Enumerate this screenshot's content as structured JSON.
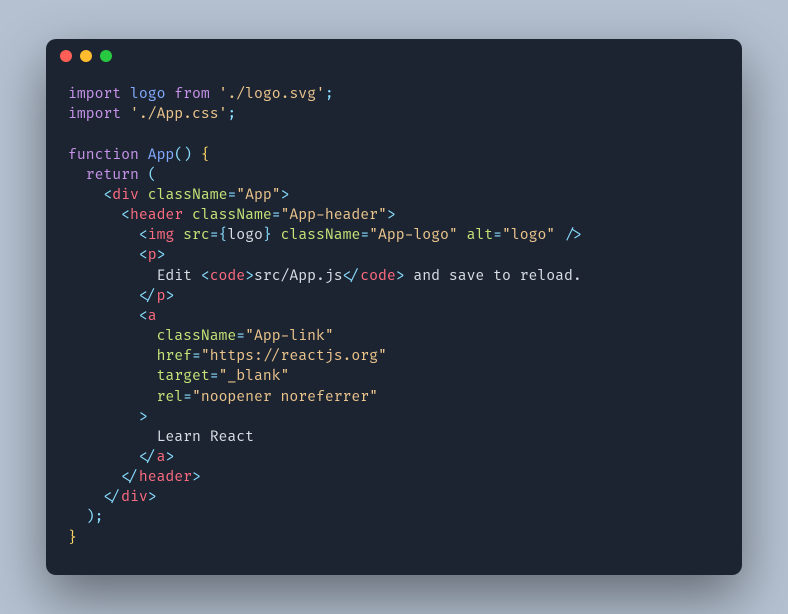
{
  "window": {
    "traffic_lights": [
      "close",
      "minimize",
      "zoom"
    ]
  },
  "code": {
    "language": "javascript-jsx",
    "filename_hint": "App.js",
    "tokens": [
      {
        "t": "kw",
        "v": "import"
      },
      {
        "t": "sp",
        "v": " "
      },
      {
        "t": "def",
        "v": "logo"
      },
      {
        "t": "sp",
        "v": " "
      },
      {
        "t": "from",
        "v": "from"
      },
      {
        "t": "sp",
        "v": " "
      },
      {
        "t": "str",
        "v": "'./logo.svg'"
      },
      {
        "t": "punc",
        "v": ";"
      },
      {
        "t": "nl"
      },
      {
        "t": "kw",
        "v": "import"
      },
      {
        "t": "sp",
        "v": " "
      },
      {
        "t": "str",
        "v": "'./App.css'"
      },
      {
        "t": "punc",
        "v": ";"
      },
      {
        "t": "nl"
      },
      {
        "t": "nl"
      },
      {
        "t": "kw",
        "v": "function"
      },
      {
        "t": "sp",
        "v": " "
      },
      {
        "t": "def",
        "v": "App"
      },
      {
        "t": "punc",
        "v": "()"
      },
      {
        "t": "sp",
        "v": " "
      },
      {
        "t": "brace",
        "v": "{"
      },
      {
        "t": "nl"
      },
      {
        "t": "sp",
        "v": "  "
      },
      {
        "t": "kw",
        "v": "return"
      },
      {
        "t": "sp",
        "v": " "
      },
      {
        "t": "punc",
        "v": "("
      },
      {
        "t": "nl"
      },
      {
        "t": "sp",
        "v": "    "
      },
      {
        "t": "punc",
        "v": "<"
      },
      {
        "t": "tag",
        "v": "div"
      },
      {
        "t": "sp",
        "v": " "
      },
      {
        "t": "attr",
        "v": "className"
      },
      {
        "t": "punc",
        "v": "="
      },
      {
        "t": "str",
        "v": "\"App\""
      },
      {
        "t": "punc",
        "v": ">"
      },
      {
        "t": "nl"
      },
      {
        "t": "sp",
        "v": "      "
      },
      {
        "t": "punc",
        "v": "<"
      },
      {
        "t": "tag",
        "v": "header"
      },
      {
        "t": "sp",
        "v": " "
      },
      {
        "t": "attr",
        "v": "className"
      },
      {
        "t": "punc",
        "v": "="
      },
      {
        "t": "str",
        "v": "\"App-header\""
      },
      {
        "t": "punc",
        "v": ">"
      },
      {
        "t": "nl"
      },
      {
        "t": "sp",
        "v": "        "
      },
      {
        "t": "punc",
        "v": "<"
      },
      {
        "t": "tag",
        "v": "img"
      },
      {
        "t": "sp",
        "v": " "
      },
      {
        "t": "attr",
        "v": "src"
      },
      {
        "t": "punc",
        "v": "="
      },
      {
        "t": "punc",
        "v": "{"
      },
      {
        "t": "expr",
        "v": "logo"
      },
      {
        "t": "punc",
        "v": "}"
      },
      {
        "t": "sp",
        "v": " "
      },
      {
        "t": "attr",
        "v": "className"
      },
      {
        "t": "punc",
        "v": "="
      },
      {
        "t": "str",
        "v": "\"App-logo\""
      },
      {
        "t": "sp",
        "v": " "
      },
      {
        "t": "attr",
        "v": "alt"
      },
      {
        "t": "punc",
        "v": "="
      },
      {
        "t": "str",
        "v": "\"logo\""
      },
      {
        "t": "sp",
        "v": " "
      },
      {
        "t": "punc",
        "v": "/>"
      },
      {
        "t": "nl"
      },
      {
        "t": "sp",
        "v": "        "
      },
      {
        "t": "punc",
        "v": "<"
      },
      {
        "t": "tag",
        "v": "p"
      },
      {
        "t": "punc",
        "v": ">"
      },
      {
        "t": "nl"
      },
      {
        "t": "sp",
        "v": "          "
      },
      {
        "t": "text",
        "v": "Edit "
      },
      {
        "t": "punc",
        "v": "<"
      },
      {
        "t": "tag",
        "v": "code"
      },
      {
        "t": "punc",
        "v": ">"
      },
      {
        "t": "text",
        "v": "src/App.js"
      },
      {
        "t": "punc",
        "v": "</"
      },
      {
        "t": "tag",
        "v": "code"
      },
      {
        "t": "punc",
        "v": ">"
      },
      {
        "t": "text",
        "v": " and save to reload."
      },
      {
        "t": "nl"
      },
      {
        "t": "sp",
        "v": "        "
      },
      {
        "t": "punc",
        "v": "</"
      },
      {
        "t": "tag",
        "v": "p"
      },
      {
        "t": "punc",
        "v": ">"
      },
      {
        "t": "nl"
      },
      {
        "t": "sp",
        "v": "        "
      },
      {
        "t": "punc",
        "v": "<"
      },
      {
        "t": "tag",
        "v": "a"
      },
      {
        "t": "nl"
      },
      {
        "t": "sp",
        "v": "          "
      },
      {
        "t": "attr",
        "v": "className"
      },
      {
        "t": "punc",
        "v": "="
      },
      {
        "t": "str",
        "v": "\"App-link\""
      },
      {
        "t": "nl"
      },
      {
        "t": "sp",
        "v": "          "
      },
      {
        "t": "attr",
        "v": "href"
      },
      {
        "t": "punc",
        "v": "="
      },
      {
        "t": "str",
        "v": "\"https://reactjs.org\""
      },
      {
        "t": "nl"
      },
      {
        "t": "sp",
        "v": "          "
      },
      {
        "t": "attr",
        "v": "target"
      },
      {
        "t": "punc",
        "v": "="
      },
      {
        "t": "str",
        "v": "\"_blank\""
      },
      {
        "t": "nl"
      },
      {
        "t": "sp",
        "v": "          "
      },
      {
        "t": "attr",
        "v": "rel"
      },
      {
        "t": "punc",
        "v": "="
      },
      {
        "t": "str",
        "v": "\"noopener noreferrer\""
      },
      {
        "t": "nl"
      },
      {
        "t": "sp",
        "v": "        "
      },
      {
        "t": "punc",
        "v": ">"
      },
      {
        "t": "nl"
      },
      {
        "t": "sp",
        "v": "          "
      },
      {
        "t": "text",
        "v": "Learn React"
      },
      {
        "t": "nl"
      },
      {
        "t": "sp",
        "v": "        "
      },
      {
        "t": "punc",
        "v": "</"
      },
      {
        "t": "tag",
        "v": "a"
      },
      {
        "t": "punc",
        "v": ">"
      },
      {
        "t": "nl"
      },
      {
        "t": "sp",
        "v": "      "
      },
      {
        "t": "punc",
        "v": "</"
      },
      {
        "t": "tag",
        "v": "header"
      },
      {
        "t": "punc",
        "v": ">"
      },
      {
        "t": "nl"
      },
      {
        "t": "sp",
        "v": "    "
      },
      {
        "t": "punc",
        "v": "</"
      },
      {
        "t": "tag",
        "v": "div"
      },
      {
        "t": "punc",
        "v": ">"
      },
      {
        "t": "nl"
      },
      {
        "t": "sp",
        "v": "  "
      },
      {
        "t": "punc",
        "v": ");"
      },
      {
        "t": "nl"
      },
      {
        "t": "brace",
        "v": "}"
      }
    ]
  }
}
